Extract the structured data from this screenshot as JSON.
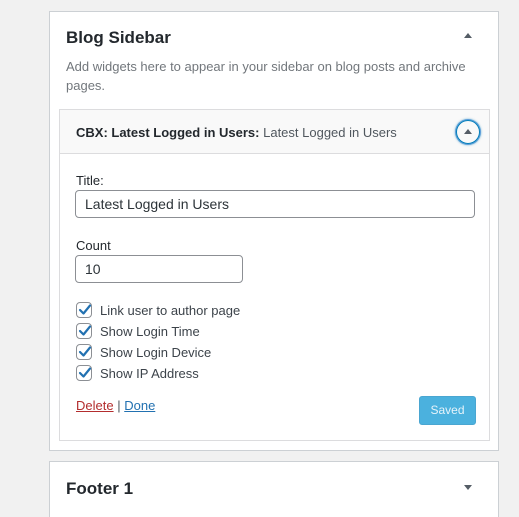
{
  "blog_sidebar": {
    "title": "Blog Sidebar",
    "description": "Add widgets here to appear in your sidebar on blog posts and archive pages."
  },
  "widget": {
    "name": "CBX: Latest Logged in Users",
    "name_suffix": ":",
    "instance_title": "Latest Logged in Users",
    "title_label": "Title:",
    "title_value": "Latest Logged in Users",
    "count_label": "Count",
    "count_value": "10",
    "checkboxes": [
      {
        "label": "Link user to author page",
        "checked": true
      },
      {
        "label": "Show Login Time",
        "checked": true
      },
      {
        "label": "Show Login Device",
        "checked": true
      },
      {
        "label": "Show IP Address",
        "checked": true
      }
    ],
    "delete_label": "Delete",
    "separator": "|",
    "done_label": "Done",
    "save_label": "Saved"
  },
  "footer_sidebar": {
    "title": "Footer 1"
  },
  "colors": {
    "accent": "#007cba",
    "checkmark": "#2271b1",
    "delete": "#b32d2e"
  }
}
